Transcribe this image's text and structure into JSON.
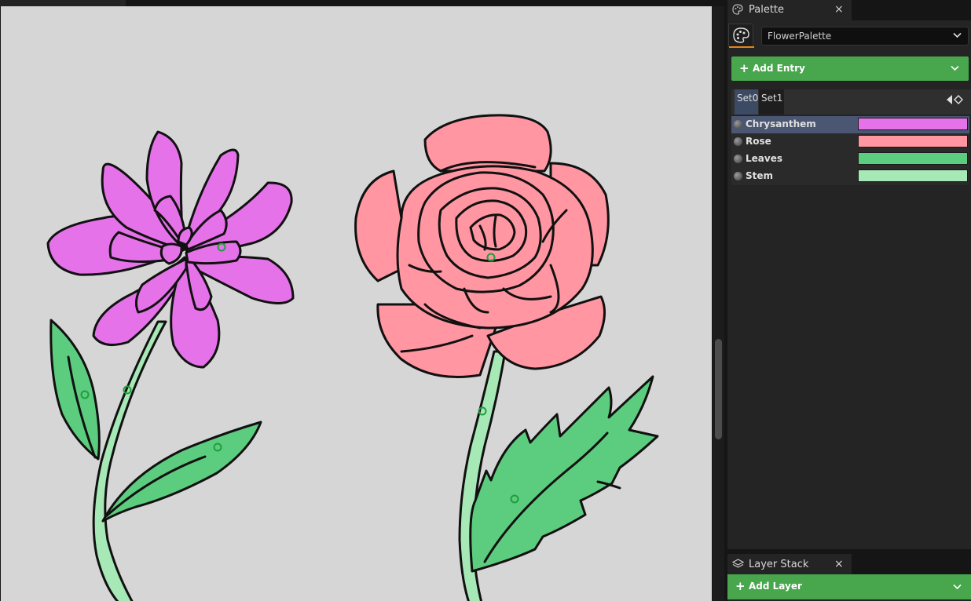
{
  "palette_panel": {
    "tab_title": "Palette",
    "tab_icon": "palette-icon",
    "close_glyph": "×",
    "palette_name": "FlowerPalette",
    "add_entry_label": "Add Entry",
    "sets": [
      "Set0",
      "Set1"
    ],
    "active_set": "Set0",
    "entries": [
      {
        "name": "Chrysanthem",
        "color": "#e672ea",
        "selected": true
      },
      {
        "name": "Rose",
        "color": "#ff96a1",
        "selected": false
      },
      {
        "name": "Leaves",
        "color": "#5ccc7f",
        "selected": false
      },
      {
        "name": "Stem",
        "color": "#a6e8b6",
        "selected": false
      }
    ]
  },
  "layer_stack_panel": {
    "tab_title": "Layer Stack",
    "tab_icon": "layers-icon",
    "close_glyph": "×",
    "add_layer_label": "Add Layer"
  },
  "canvas": {
    "background": "#d6d6d6",
    "outline_color": "#111111",
    "fill_marker_color": "#1f9e3c"
  },
  "accent": {
    "add_button": "#48a64d",
    "selection": "#4a5672",
    "active_tab": "#e8821e"
  }
}
